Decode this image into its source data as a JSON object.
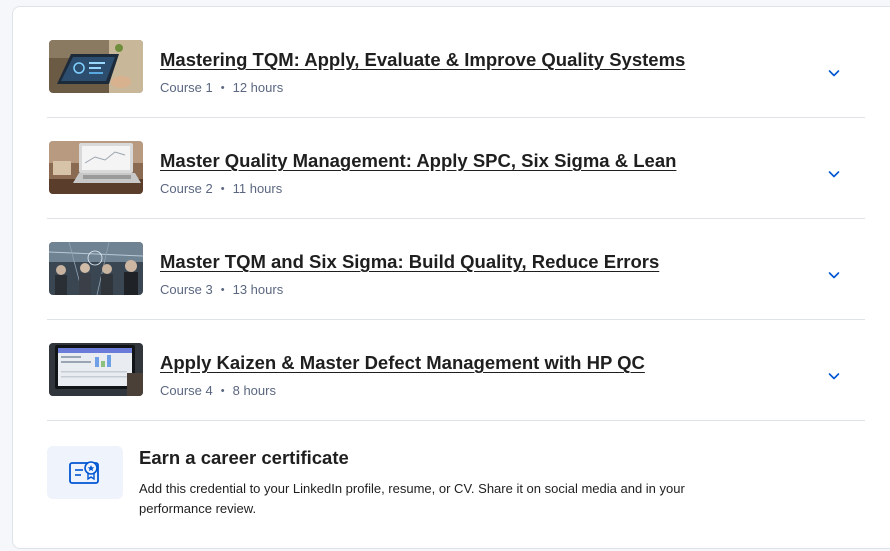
{
  "courses": [
    {
      "title": "Mastering TQM: Apply, Evaluate & Improve Quality Systems",
      "course_label": "Course 1",
      "duration": "12 hours"
    },
    {
      "title": "Master Quality Management: Apply SPC, Six Sigma & Lean",
      "course_label": "Course 2",
      "duration": "11 hours"
    },
    {
      "title": "Master TQM and Six Sigma: Build Quality, Reduce Errors",
      "course_label": "Course 3",
      "duration": "13 hours"
    },
    {
      "title": "Apply Kaizen & Master Defect Management with HP QC",
      "course_label": "Course 4",
      "duration": "8 hours"
    }
  ],
  "meta_separator": "•",
  "certificate": {
    "title": "Earn a career certificate",
    "description": "Add this credential to your LinkedIn profile, resume, or CV. Share it on social media and in your performance review.",
    "icon": "certificate-icon"
  },
  "icons": {
    "expand": "chevron-down-icon"
  },
  "colors": {
    "accent": "#0056d2",
    "text": "#1f1f1f",
    "muted": "#5b6780",
    "divider": "#dfe3e8",
    "icon_bg": "#eef3fc"
  }
}
